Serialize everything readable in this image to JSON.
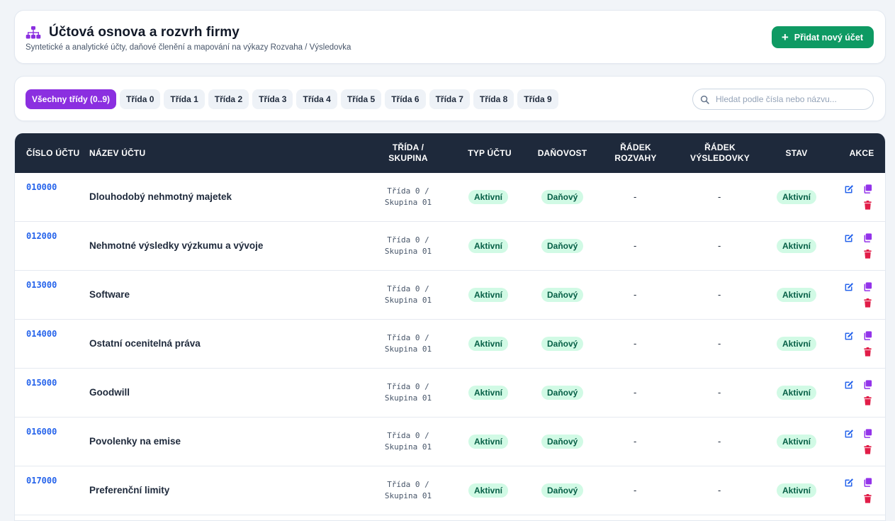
{
  "header": {
    "title": "Účtová osnova a rozvrh firmy",
    "subtitle": "Syntetické a analytické účty, daňové členění a mapování na výkazy Rozvaha / Výsledovka",
    "add_button_label": "Přidat nový účet",
    "icon": "sitemap-icon"
  },
  "filters": {
    "chips": [
      {
        "label": "Všechny třídy (0..9)",
        "active": true
      },
      {
        "label": "Třída 0",
        "active": false
      },
      {
        "label": "Třída 1",
        "active": false
      },
      {
        "label": "Třída 2",
        "active": false
      },
      {
        "label": "Třída 3",
        "active": false
      },
      {
        "label": "Třída 4",
        "active": false
      },
      {
        "label": "Třída 5",
        "active": false
      },
      {
        "label": "Třída 6",
        "active": false
      },
      {
        "label": "Třída 7",
        "active": false
      },
      {
        "label": "Třída 8",
        "active": false
      },
      {
        "label": "Třída 9",
        "active": false
      }
    ],
    "search_placeholder": "Hledat podle čísla nebo názvu...",
    "search_value": ""
  },
  "table": {
    "columns": {
      "number": "ČÍSLO ÚČTU",
      "name": "NÁZEV ÚČTU",
      "class_group": "TŘÍDA / SKUPINA",
      "type": "TYP ÚČTU",
      "tax": "DAŇOVOST",
      "balance_line": "ŘÁDEK ROZVAHY",
      "income_line": "ŘÁDEK VÝSLEDOVKY",
      "status": "STAV",
      "actions": "AKCE"
    },
    "rows": [
      {
        "number": "010000",
        "name": "Dlouhodobý nehmotný majetek",
        "class_line": "Třída 0 /",
        "group_line": "Skupina 01",
        "type": "Aktivní",
        "tax": "Daňový",
        "balance_line": "-",
        "income_line": "-",
        "status": "Aktivní"
      },
      {
        "number": "012000",
        "name": "Nehmotné výsledky výzkumu a vývoje",
        "class_line": "Třída 0 /",
        "group_line": "Skupina 01",
        "type": "Aktivní",
        "tax": "Daňový",
        "balance_line": "-",
        "income_line": "-",
        "status": "Aktivní"
      },
      {
        "number": "013000",
        "name": "Software",
        "class_line": "Třída 0 /",
        "group_line": "Skupina 01",
        "type": "Aktivní",
        "tax": "Daňový",
        "balance_line": "-",
        "income_line": "-",
        "status": "Aktivní"
      },
      {
        "number": "014000",
        "name": "Ostatní ocenitelná práva",
        "class_line": "Třída 0 /",
        "group_line": "Skupina 01",
        "type": "Aktivní",
        "tax": "Daňový",
        "balance_line": "-",
        "income_line": "-",
        "status": "Aktivní"
      },
      {
        "number": "015000",
        "name": "Goodwill",
        "class_line": "Třída 0 /",
        "group_line": "Skupina 01",
        "type": "Aktivní",
        "tax": "Daňový",
        "balance_line": "-",
        "income_line": "-",
        "status": "Aktivní"
      },
      {
        "number": "016000",
        "name": "Povolenky na emise",
        "class_line": "Třída 0 /",
        "group_line": "Skupina 01",
        "type": "Aktivní",
        "tax": "Daňový",
        "balance_line": "-",
        "income_line": "-",
        "status": "Aktivní"
      },
      {
        "number": "017000",
        "name": "Preferenční limity",
        "class_line": "Třída 0 /",
        "group_line": "Skupina 01",
        "type": "Aktivní",
        "tax": "Daňový",
        "balance_line": "-",
        "income_line": "-",
        "status": "Aktivní"
      }
    ]
  },
  "colors": {
    "accent_purple": "#8b2fe0",
    "primary_green": "#0e9a63",
    "header_dark": "#1e293b",
    "link_blue": "#2563eb",
    "badge_green_bg": "#d1fae5",
    "badge_green_text": "#065f46",
    "delete_red": "#e11d48"
  },
  "icons": {
    "edit": "edit-icon",
    "copy": "copy-icon",
    "delete": "trash-icon",
    "search": "search-icon"
  }
}
